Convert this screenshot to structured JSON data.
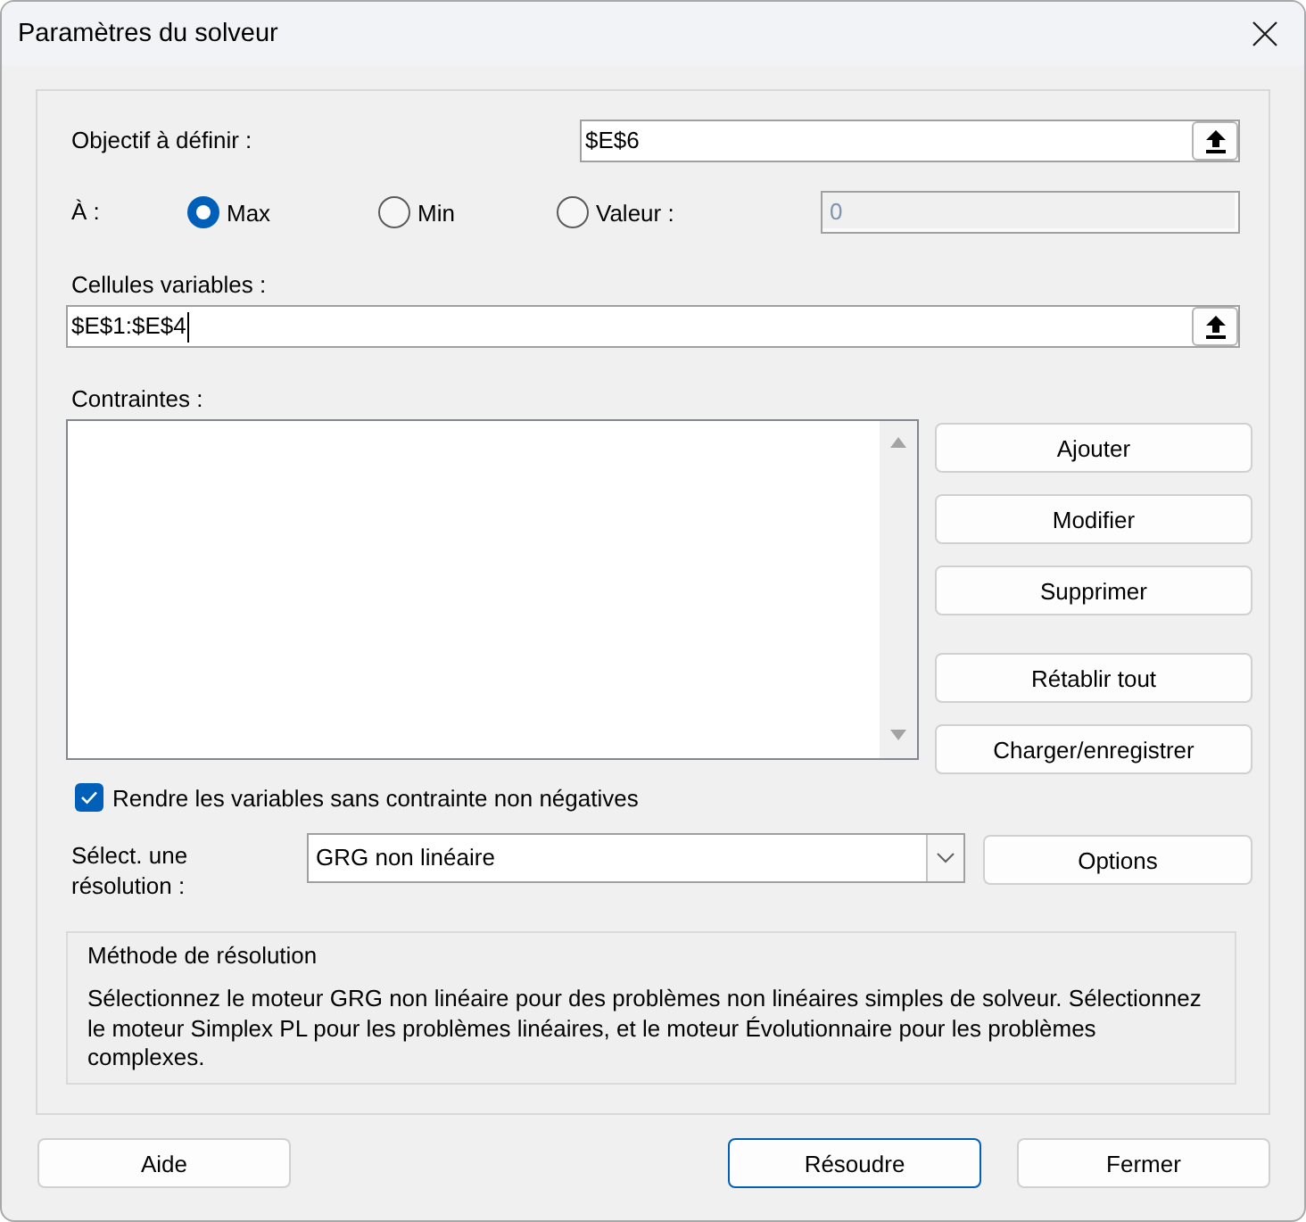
{
  "window": {
    "title": "Paramètres du solveur"
  },
  "objective": {
    "label": "Objectif à définir :",
    "value": "$E$6"
  },
  "target": {
    "label": "À :",
    "options": [
      {
        "label": "Max",
        "selected": true
      },
      {
        "label": "Min",
        "selected": false
      },
      {
        "label": "Valeur :",
        "selected": false
      }
    ],
    "value": "0",
    "disabled": true
  },
  "variables": {
    "label": "Cellules variables :",
    "value": "$E$1:$E$4",
    "focused": true
  },
  "constraints": {
    "label": "Contraintes :",
    "buttons": [
      {
        "label": "Ajouter"
      },
      {
        "label": "Modifier"
      },
      {
        "label": "Supprimer"
      },
      {
        "label": "Rétablir tout"
      },
      {
        "label": "Charger/enregistrer"
      }
    ]
  },
  "nonnegative": {
    "label": "Rendre les variables sans contrainte non négatives",
    "checked": true
  },
  "solving_method": {
    "label": "Sélect. une résolution :",
    "value": "GRG non linéaire",
    "button": {
      "label": "Options"
    }
  },
  "method_description": {
    "title": "Méthode de résolution",
    "text": "Sélectionnez le moteur GRG non linéaire pour des problèmes non linéaires simples de solveur. Sélectionnez le moteur Simplex PL pour les problèmes linéaires, et le moteur Évolutionnaire pour les problèmes complexes."
  },
  "footer_buttons": [
    {
      "label": "Aide",
      "default": false
    },
    {
      "label": "Résoudre",
      "default": true
    },
    {
      "label": "Fermer",
      "default": false
    }
  ]
}
